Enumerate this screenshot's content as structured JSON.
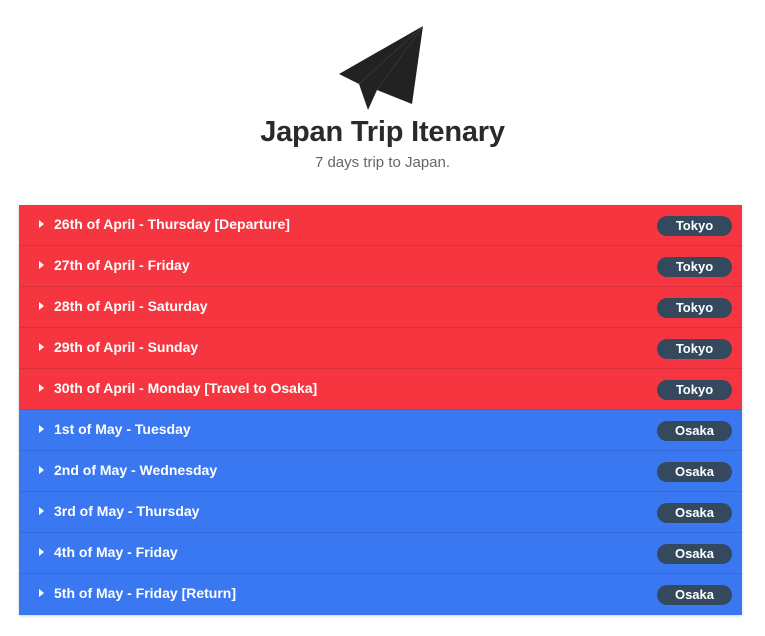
{
  "header": {
    "icon": "paper-plane-icon",
    "title": "Japan Trip Itenary",
    "subtitle": "7 days trip to Japan."
  },
  "colors": {
    "tokyo_row": "#f5353f",
    "osaka_row": "#3a78f2",
    "badge": "#34495e"
  },
  "itinerary": [
    {
      "label": "26th of April - Thursday [Departure]",
      "city": "Tokyo",
      "color": "red"
    },
    {
      "label": "27th of April - Friday",
      "city": "Tokyo",
      "color": "red"
    },
    {
      "label": "28th of April - Saturday",
      "city": "Tokyo",
      "color": "red"
    },
    {
      "label": "29th of April - Sunday",
      "city": "Tokyo",
      "color": "red"
    },
    {
      "label": "30th of April - Monday [Travel to Osaka]",
      "city": "Tokyo",
      "color": "red"
    },
    {
      "label": "1st of May - Tuesday",
      "city": "Osaka",
      "color": "blue"
    },
    {
      "label": "2nd of May - Wednesday",
      "city": "Osaka",
      "color": "blue"
    },
    {
      "label": "3rd of May - Thursday",
      "city": "Osaka",
      "color": "blue"
    },
    {
      "label": "4th of May - Friday",
      "city": "Osaka",
      "color": "blue"
    },
    {
      "label": "5th of May - Friday [Return]",
      "city": "Osaka",
      "color": "blue"
    }
  ]
}
